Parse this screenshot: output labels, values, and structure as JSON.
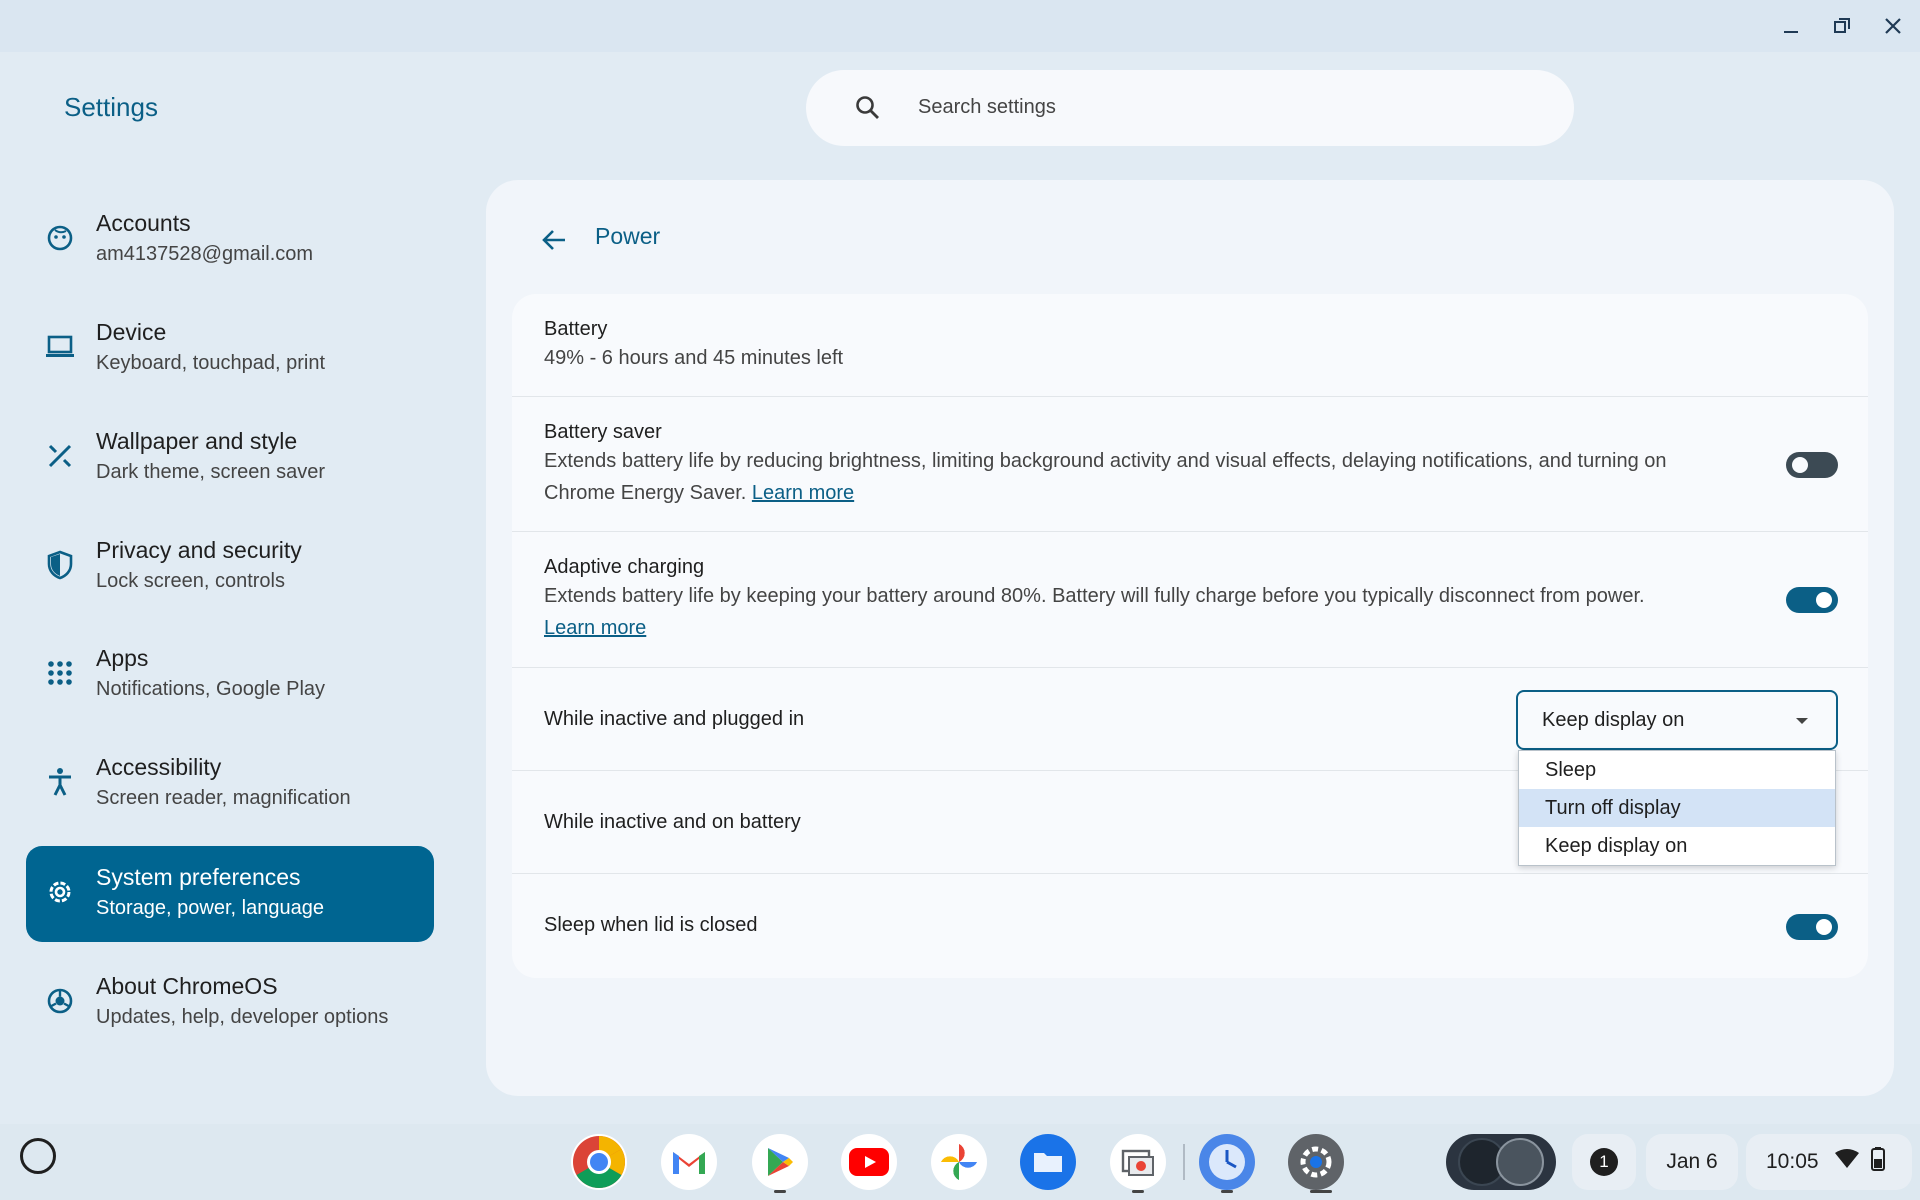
{
  "window": {
    "minimize_icon": "minimize-icon",
    "restore_icon": "restore-icon",
    "close_icon": "close-icon"
  },
  "app": {
    "title": "Settings"
  },
  "search": {
    "placeholder": "Search settings",
    "icon": "search-icon"
  },
  "sidebar": {
    "items": [
      {
        "title": "Accounts",
        "subtitle": "am4137528@gmail.com",
        "icon": "account-face-icon"
      },
      {
        "title": "Device",
        "subtitle": "Keyboard, touchpad, print",
        "icon": "laptop-icon"
      },
      {
        "title": "Wallpaper and style",
        "subtitle": "Dark theme, screen saver",
        "icon": "paint-brush-icon"
      },
      {
        "title": "Privacy and security",
        "subtitle": "Lock screen, controls",
        "icon": "shield-icon"
      },
      {
        "title": "Apps",
        "subtitle": "Notifications, Google Play",
        "icon": "apps-grid-icon"
      },
      {
        "title": "Accessibility",
        "subtitle": "Screen reader, magnification",
        "icon": "accessibility-icon"
      },
      {
        "title": "System preferences",
        "subtitle": "Storage, power, language",
        "icon": "gear-icon",
        "active": true
      },
      {
        "title": "About ChromeOS",
        "subtitle": "Updates, help, developer options",
        "icon": "chromeos-icon"
      }
    ]
  },
  "page": {
    "title": "Power",
    "back_icon": "back-arrow-icon",
    "battery": {
      "label": "Battery",
      "status": "49% - 6 hours and 45 minutes left"
    },
    "battery_saver": {
      "label": "Battery saver",
      "desc_1": "Extends battery life by reducing brightness, limiting background activity and visual effects, delaying notifications, and turning on",
      "desc_2": "Chrome Energy Saver.",
      "link": "Learn more",
      "enabled": false
    },
    "adaptive_charging": {
      "label": "Adaptive charging",
      "desc": "Extends battery life by keeping your battery around 80%. Battery will fully charge before you typically disconnect from power.",
      "link": "Learn more",
      "enabled": true
    },
    "plugged_in": {
      "label": "While inactive and plugged in",
      "selected": "Keep display on",
      "options": [
        "Sleep",
        "Turn off display",
        "Keep display on"
      ],
      "highlighted": "Turn off display"
    },
    "on_battery": {
      "label": "While inactive and on battery"
    },
    "lid": {
      "label": "Sleep when lid is closed",
      "enabled": true
    }
  },
  "shelf": {
    "apps": [
      "chrome-icon",
      "gmail-icon",
      "play-store-icon",
      "youtube-icon",
      "photos-icon",
      "files-icon",
      "screen-capture-icon",
      "clock-icon",
      "settings-gear-icon"
    ],
    "notification_count": "1",
    "date": "Jan 6",
    "time": "10:05",
    "colors": {
      "accent": "#0b5f86",
      "active_nav": "#006591"
    }
  }
}
